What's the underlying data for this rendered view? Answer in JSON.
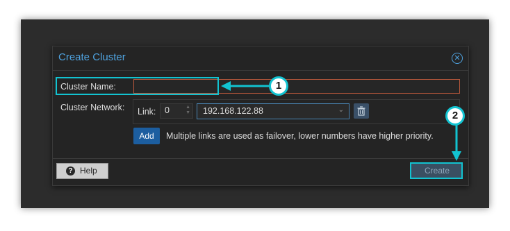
{
  "dialog": {
    "title": "Create Cluster",
    "close_icon": "close-circle-icon"
  },
  "form": {
    "cluster_name_label": "Cluster Name:",
    "cluster_name_value": "",
    "cluster_network_label": "Cluster Network:",
    "link_label": "Link:",
    "link_number": "0",
    "link_address": "192.168.122.88",
    "add_label": "Add",
    "failover_note": "Multiple links are used as failover, lower numbers have higher priority."
  },
  "footer": {
    "help_label": "Help",
    "create_label": "Create"
  },
  "annotations": {
    "badge_1": "1",
    "badge_2": "2",
    "highlight_color": "#12c3d1"
  },
  "colors": {
    "title": "#4fa3e0",
    "name_input_border": "#b5573b",
    "add_button": "#1c5ea0",
    "create_button": "#3a4f62"
  }
}
